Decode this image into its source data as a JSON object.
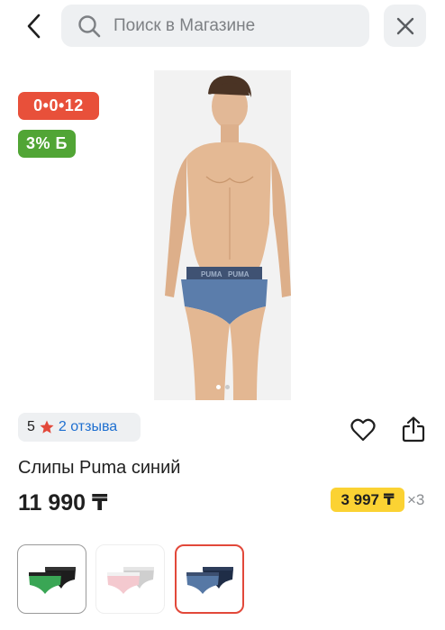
{
  "search": {
    "placeholder": "Поиск в Магазине"
  },
  "badges": {
    "installment": "0•0•12",
    "bonus": "3% Б"
  },
  "rating": {
    "score": "5",
    "reviews": "2 отзыва"
  },
  "product": {
    "title": "Слипы Puma синий",
    "price": "11 990 ₸",
    "monthly_payment": "3 997 ₸",
    "multiplier": "×3"
  },
  "gallery": {
    "slides": 2,
    "active": 1
  },
  "thumbnails": [
    {
      "name": "green-black",
      "selected": false
    },
    {
      "name": "pink-grey",
      "selected": false
    },
    {
      "name": "blue-navy",
      "selected": true
    }
  ],
  "colors": {
    "installment_badge": "#e8503a",
    "bonus_badge": "#51a535",
    "monthly_badge": "#fbd233",
    "link": "#1e6fd0",
    "selected_thumb_border": "#e2483a"
  }
}
